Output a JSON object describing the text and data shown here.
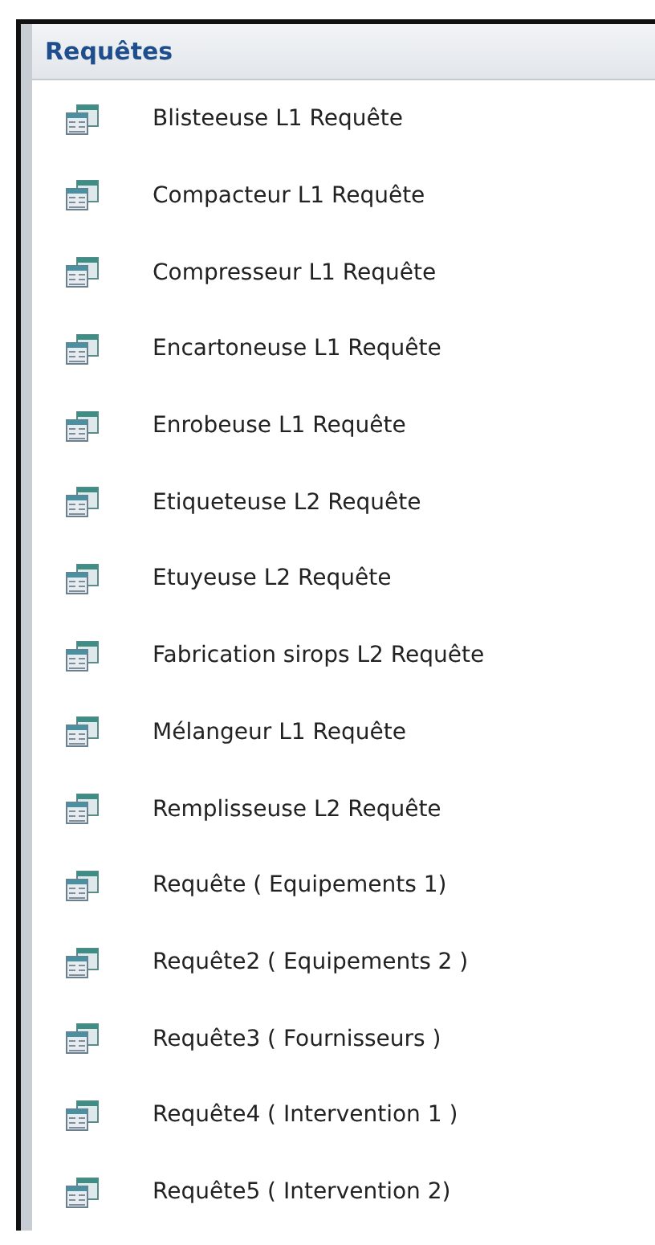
{
  "group": {
    "title": "Requêtes"
  },
  "items": [
    {
      "label": "Blisteeuse L1 Requête"
    },
    {
      "label": "Compacteur L1 Requête"
    },
    {
      "label": "Compresseur L1 Requête"
    },
    {
      "label": "Encartoneuse L1 Requête"
    },
    {
      "label": "Enrobeuse L1 Requête"
    },
    {
      "label": "Etiqueteuse L2 Requête"
    },
    {
      "label": "Etuyeuse L2 Requête"
    },
    {
      "label": "Fabrication sirops L2 Requête"
    },
    {
      "label": "Mélangeur L1 Requête"
    },
    {
      "label": "Remplisseuse L2 Requête"
    },
    {
      "label": "Requête ( Equipements 1)"
    },
    {
      "label": "Requête2 ( Equipements 2 )"
    },
    {
      "label": "Requête3 ( Fournisseurs )"
    },
    {
      "label": "Requête4 ( Intervention 1 )"
    },
    {
      "label": "Requête5 ( Intervention 2)"
    }
  ]
}
